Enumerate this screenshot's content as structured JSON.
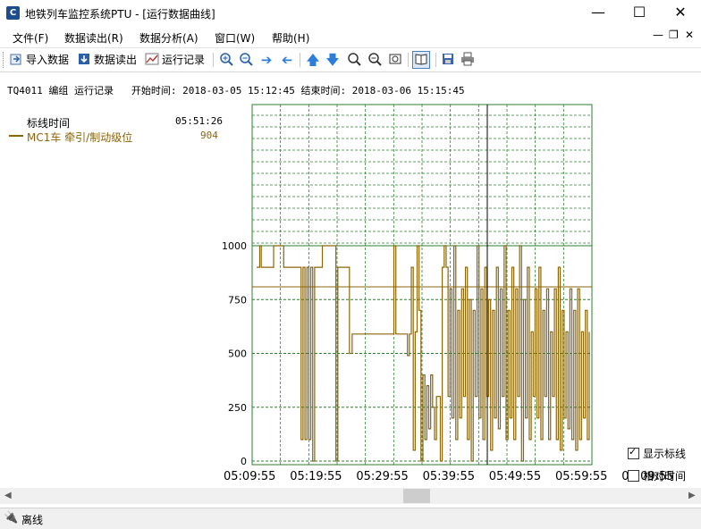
{
  "window": {
    "title": "地铁列车监控系统PTU - [运行数据曲线]",
    "icon": "app-logo-icon"
  },
  "menu": {
    "items": [
      "文件(F)",
      "数据读出(R)",
      "数据分析(A)",
      "窗口(W)",
      "帮助(H)"
    ]
  },
  "toolbar": {
    "import_label": "导入数据",
    "read_label": "数据读出",
    "run_label": "运行记录",
    "icons": [
      "zoom-in-icon",
      "zoom-out-icon",
      "arrow-right-icon",
      "arrow-left-icon",
      "arrow-up-icon",
      "arrow-down-icon",
      "zoom-fit-icon",
      "zoom-reset-icon",
      "target-icon",
      "book-icon",
      "save-icon",
      "print-icon"
    ]
  },
  "info_line": "TQ4011 编组 运行记录   开始时间: 2018-03-05 15:12:45 结束时间: 2018-03-06 15:15:45",
  "legend": {
    "time_label": "标线时间",
    "time_value": "05:51:26",
    "series_label": "MC1车 牵引/制动级位",
    "series_value": "904",
    "series_color": "#8b6508"
  },
  "options": {
    "show_marker_label": "显示标线",
    "show_marker_checked": true,
    "relative_time_label": "相对时间",
    "relative_time_checked": false
  },
  "status": {
    "text": "离线"
  },
  "chart_data": {
    "type": "line",
    "series": [
      {
        "name": "MC1车 牵引/制动级位",
        "color": "#8b6508"
      }
    ],
    "x_tick_labels": [
      "05:09:55",
      "05:19:55",
      "05:29:55",
      "05:39:55",
      "05:49:55",
      "05:59:55",
      "06:09:55"
    ],
    "ylim": [
      0,
      1000
    ],
    "y_tick_labels": [
      "0",
      "250",
      "500",
      "750",
      "1000"
    ],
    "marker": {
      "time": "05:51:26",
      "value": 904
    },
    "grid": true,
    "points": [
      [
        0,
        900
      ],
      [
        0.8,
        1000
      ],
      [
        1.2,
        900
      ],
      [
        4,
        900
      ],
      [
        4.4,
        1000
      ],
      [
        7,
        900
      ],
      [
        11,
        900
      ],
      [
        11.5,
        100
      ],
      [
        12,
        900
      ],
      [
        12.5,
        100
      ],
      [
        13,
        900
      ],
      [
        13.5,
        100
      ],
      [
        14,
        900
      ],
      [
        14.5,
        0
      ],
      [
        15,
        900
      ],
      [
        16.5,
        900
      ],
      [
        17,
        1000
      ],
      [
        20,
        1000
      ],
      [
        20.5,
        0
      ],
      [
        21,
        900
      ],
      [
        23.5,
        900
      ],
      [
        24,
        500
      ],
      [
        24.7,
        590
      ],
      [
        28,
        590
      ],
      [
        32,
        590
      ],
      [
        34.5,
        590
      ],
      [
        35.5,
        1000
      ],
      [
        36,
        590
      ],
      [
        38,
        590
      ],
      [
        39,
        490
      ],
      [
        39.5,
        590
      ],
      [
        40,
        900
      ],
      [
        40.5,
        50
      ],
      [
        41,
        600
      ],
      [
        41.5,
        1000
      ],
      [
        42,
        700
      ],
      [
        42.5,
        0
      ],
      [
        43,
        400
      ],
      [
        43.5,
        100
      ],
      [
        44,
        350
      ],
      [
        44.5,
        150
      ],
      [
        45,
        400
      ],
      [
        45.5,
        250
      ],
      [
        46,
        100
      ],
      [
        46.5,
        300
      ],
      [
        47.5,
        0
      ],
      [
        48,
        900
      ],
      [
        48.5,
        1000
      ],
      [
        49,
        900
      ],
      [
        49.5,
        300
      ],
      [
        50,
        800
      ],
      [
        50.5,
        200
      ],
      [
        51,
        1000
      ],
      [
        51.5,
        100
      ],
      [
        52,
        700
      ],
      [
        52.5,
        200
      ],
      [
        53,
        800
      ],
      [
        53.5,
        300
      ],
      [
        54,
        900
      ],
      [
        54.5,
        100
      ],
      [
        55,
        750
      ],
      [
        55.5,
        0
      ],
      [
        56,
        700
      ],
      [
        56.5,
        300
      ],
      [
        57,
        1000
      ],
      [
        57.5,
        200
      ],
      [
        58,
        800
      ],
      [
        58.5,
        100
      ],
      [
        59,
        900
      ],
      [
        59.5,
        300
      ],
      [
        60,
        750
      ],
      [
        60.5,
        50
      ],
      [
        61,
        700
      ],
      [
        61.5,
        200
      ],
      [
        62,
        900
      ],
      [
        62.5,
        150
      ],
      [
        63,
        800
      ],
      [
        63.5,
        300
      ],
      [
        64,
        1000
      ],
      [
        64.5,
        100
      ],
      [
        65,
        700
      ],
      [
        65.5,
        200
      ],
      [
        66,
        900
      ],
      [
        66.5,
        100
      ],
      [
        67,
        800
      ],
      [
        67.5,
        300
      ],
      [
        68,
        1000
      ],
      [
        68.5,
        0
      ],
      [
        69,
        750
      ],
      [
        69.5,
        200
      ],
      [
        70,
        900
      ],
      [
        70.5,
        100
      ],
      [
        71,
        600
      ],
      [
        71.5,
        300
      ],
      [
        72,
        800
      ],
      [
        72.5,
        200
      ],
      [
        73,
        900
      ],
      [
        73.5,
        100
      ],
      [
        74,
        700
      ],
      [
        74.5,
        300
      ],
      [
        75,
        800
      ],
      [
        75.5,
        100
      ],
      [
        76,
        600
      ],
      [
        76.5,
        300
      ],
      [
        77,
        800
      ],
      [
        77.5,
        100
      ],
      [
        78,
        900
      ],
      [
        78.5,
        50
      ],
      [
        79,
        700
      ],
      [
        79.5,
        200
      ],
      [
        80,
        600
      ],
      [
        80.5,
        150
      ],
      [
        81,
        800
      ],
      [
        81.5,
        100
      ],
      [
        82,
        700
      ],
      [
        82.5,
        50
      ],
      [
        83,
        800
      ],
      [
        83.5,
        100
      ],
      [
        84,
        600
      ],
      [
        84.5,
        200
      ],
      [
        85,
        700
      ],
      [
        85.5,
        100
      ],
      [
        86,
        600
      ]
    ]
  }
}
